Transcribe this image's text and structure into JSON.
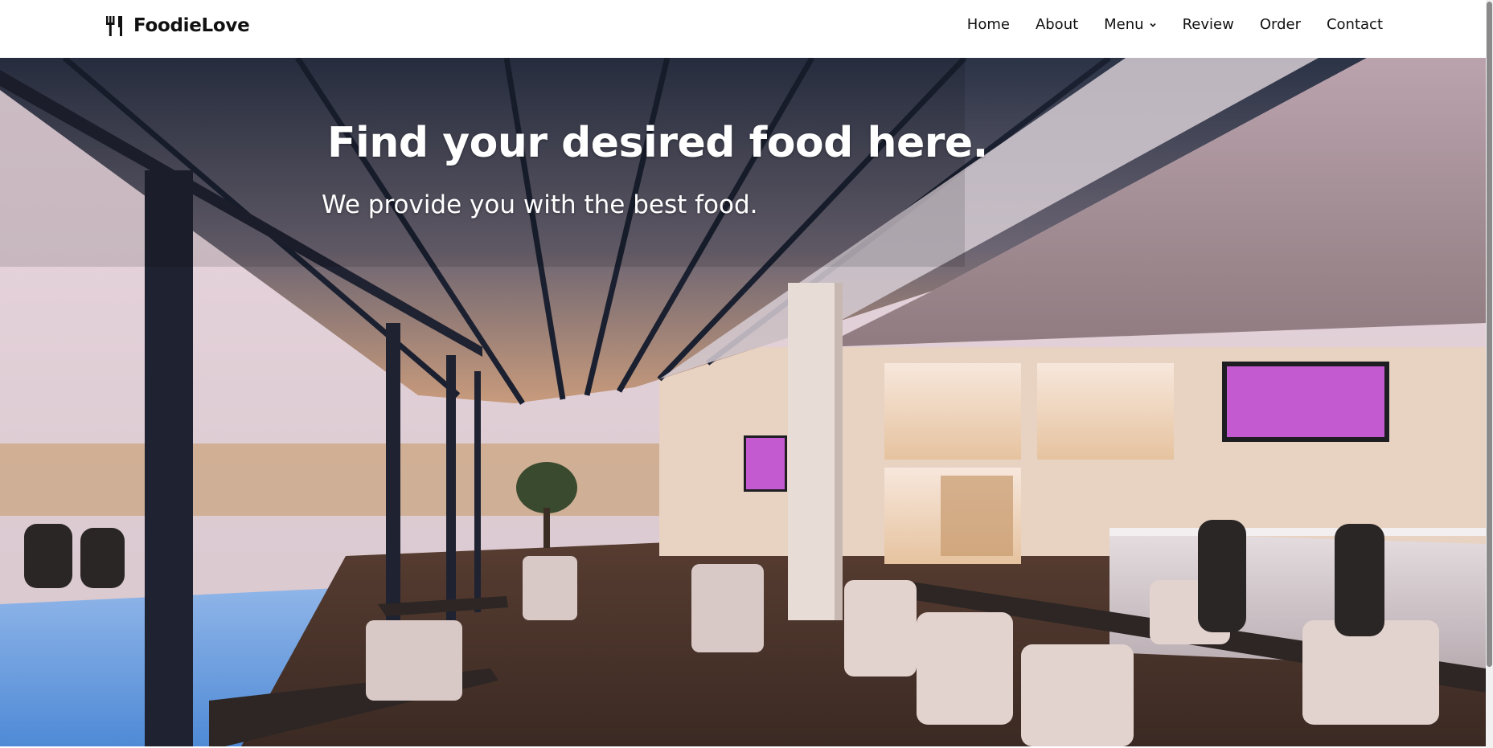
{
  "header": {
    "brand": "FoodieLove",
    "brand_icon": "fork-knife-icon",
    "nav": [
      {
        "label": "Home"
      },
      {
        "label": "About"
      },
      {
        "label": "Menu",
        "has_dropdown": true
      },
      {
        "label": "Review"
      },
      {
        "label": "Order"
      },
      {
        "label": "Contact"
      }
    ]
  },
  "hero": {
    "title": "Find your desired food here.",
    "subtitle": "We provide you with the best food.",
    "background": "restaurant-interior-photo"
  },
  "colors": {
    "nav_bg": "#ffffff",
    "text": "#111111",
    "hero_text": "#ffffff"
  }
}
